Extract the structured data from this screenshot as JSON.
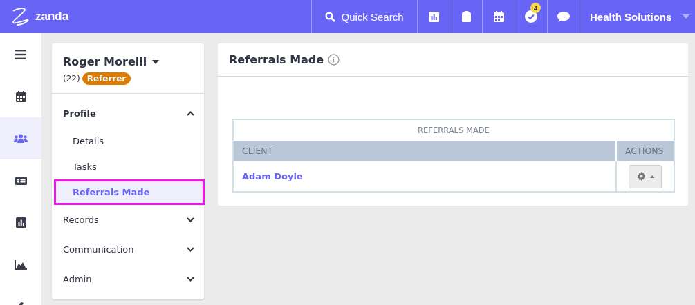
{
  "topbar": {
    "logo": "zanda",
    "search": "Quick Search",
    "tools": [
      {
        "kind": "report"
      },
      {
        "kind": "clipboard"
      },
      {
        "kind": "calendar"
      },
      {
        "kind": "tasks",
        "badge": "4"
      },
      {
        "kind": "chat"
      }
    ],
    "account": "Health Solutions"
  },
  "rail": [
    {
      "kind": "menu",
      "selected": false
    },
    {
      "kind": "calendar",
      "selected": false
    },
    {
      "kind": "people",
      "selected": true
    },
    {
      "kind": "billing",
      "selected": false
    },
    {
      "kind": "report",
      "selected": false
    },
    {
      "kind": "area",
      "selected": false
    },
    {
      "kind": "wrench",
      "selected": false
    }
  ],
  "contact": {
    "name": "Roger Morelli",
    "count": "(22)",
    "tag": "Referrer"
  },
  "nav": [
    {
      "label": "Profile",
      "expanded": true,
      "children": [
        {
          "label": "Details",
          "selected": false
        },
        {
          "label": "Tasks",
          "selected": false
        },
        {
          "label": "Referrals Made",
          "selected": true
        }
      ]
    },
    {
      "label": "Records",
      "expanded": false
    },
    {
      "label": "Communication",
      "expanded": false
    },
    {
      "label": "Admin",
      "expanded": false
    }
  ],
  "panel": {
    "title": "Referrals Made",
    "table": {
      "caption": "REFERRALS MADE",
      "columns": [
        "CLIENT",
        "ACTIONS"
      ],
      "rows": [
        {
          "client": "Adam Doyle"
        }
      ]
    }
  }
}
